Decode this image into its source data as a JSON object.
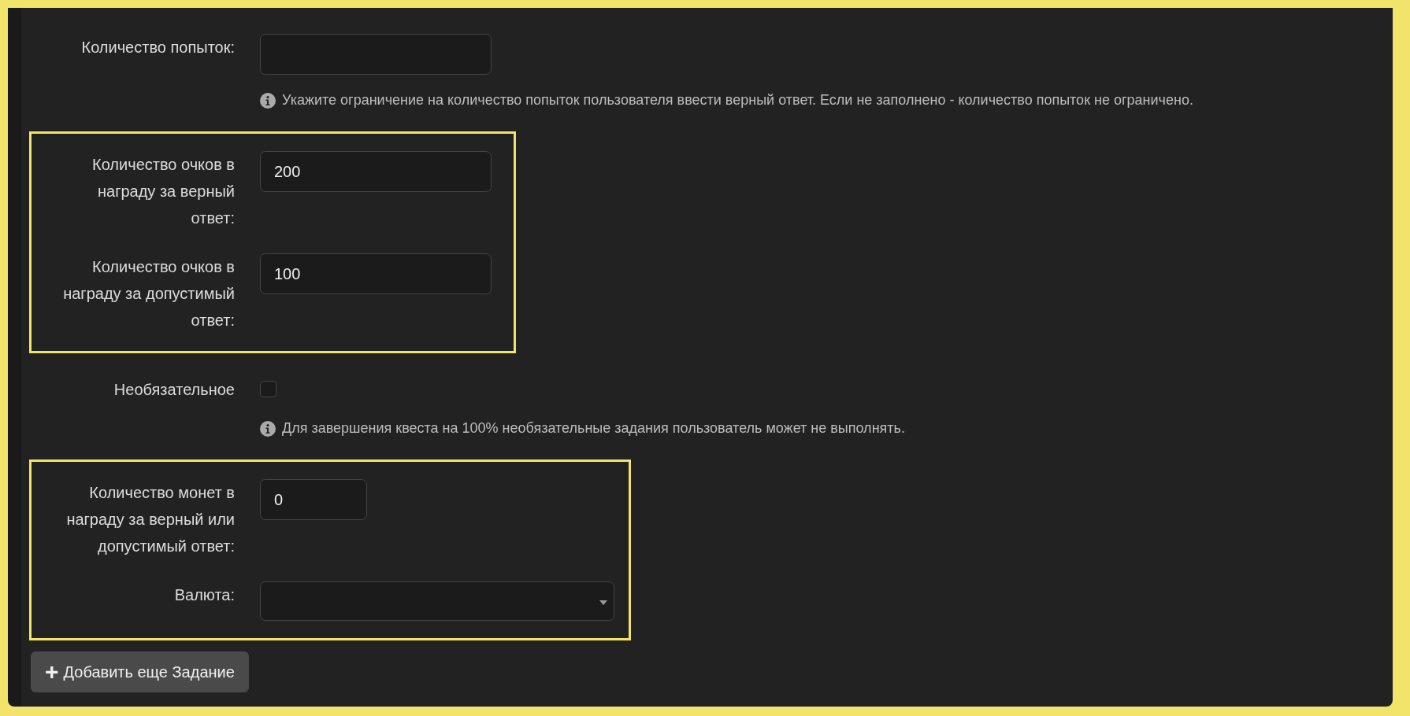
{
  "sections": [
    {
      "highlighted": false,
      "fields": [
        {
          "kind": "text",
          "label": "Количество попыток:",
          "hint": "Укажите ограничение на количество попыток пользователя ввести верный ответ. Если не заполнено - количество попыток не ограничено."
        }
      ]
    },
    {
      "highlighted": true,
      "fields": [
        {
          "kind": "text",
          "label": "Количество очков в награду за верный ответ:",
          "value": "200"
        },
        {
          "kind": "text",
          "label": "Количество очков в награду за допустимый ответ:",
          "value": "100"
        }
      ]
    },
    {
      "highlighted": false,
      "fields": [
        {
          "kind": "checkbox",
          "label": "Необязательное",
          "checked": false,
          "hint": "Для завершения квеста на 100% необязательные задания пользователь может не выполнять."
        }
      ]
    },
    {
      "highlighted": true,
      "fields": [
        {
          "kind": "number",
          "label": "Количество монет в награду за верный или допустимый ответ:",
          "value": "0"
        },
        {
          "kind": "select",
          "label": "Валюта:"
        }
      ]
    }
  ],
  "add_button": {
    "icon": "+",
    "label": "Добавить еще Задание"
  }
}
